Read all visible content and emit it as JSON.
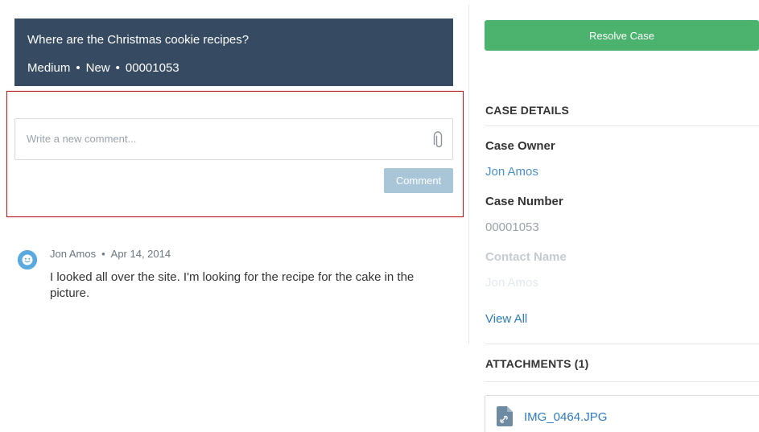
{
  "case": {
    "title": "Where are the Christmas cookie recipes?",
    "priority": "Medium",
    "status": "New",
    "number": "00001053",
    "separator": "•"
  },
  "composer": {
    "placeholder": "Write a new comment...",
    "button_label": "Comment",
    "attach_icon": "paperclip-icon"
  },
  "feed": {
    "items": [
      {
        "author": "Jon Amos",
        "date": "Apr 14, 2014",
        "body": "I looked all over the site. I'm looking for the recipe for the cake in the picture.",
        "avatar_icon": "smiley-avatar-icon"
      }
    ]
  },
  "sidebar": {
    "resolve_label": "Resolve Case",
    "details_title": "CASE DETAILS",
    "fields": [
      {
        "label": "Case Owner",
        "value": "Jon Amos"
      },
      {
        "label": "Case Number",
        "value": "00001053"
      },
      {
        "label": "Contact Name",
        "value": "Jon Amos"
      }
    ],
    "view_all": "View All",
    "attachments_title": "ATTACHMENTS (1)",
    "attachments": [
      {
        "name": "IMG_0464.JPG",
        "icon": "file-icon"
      }
    ]
  },
  "colors": {
    "header_bg": "#364b61",
    "resolve_green": "#4bb36e",
    "comment_button": "#a9c6d9",
    "highlight_red": "#b41e22",
    "link_blue": "#2d7bc0"
  }
}
